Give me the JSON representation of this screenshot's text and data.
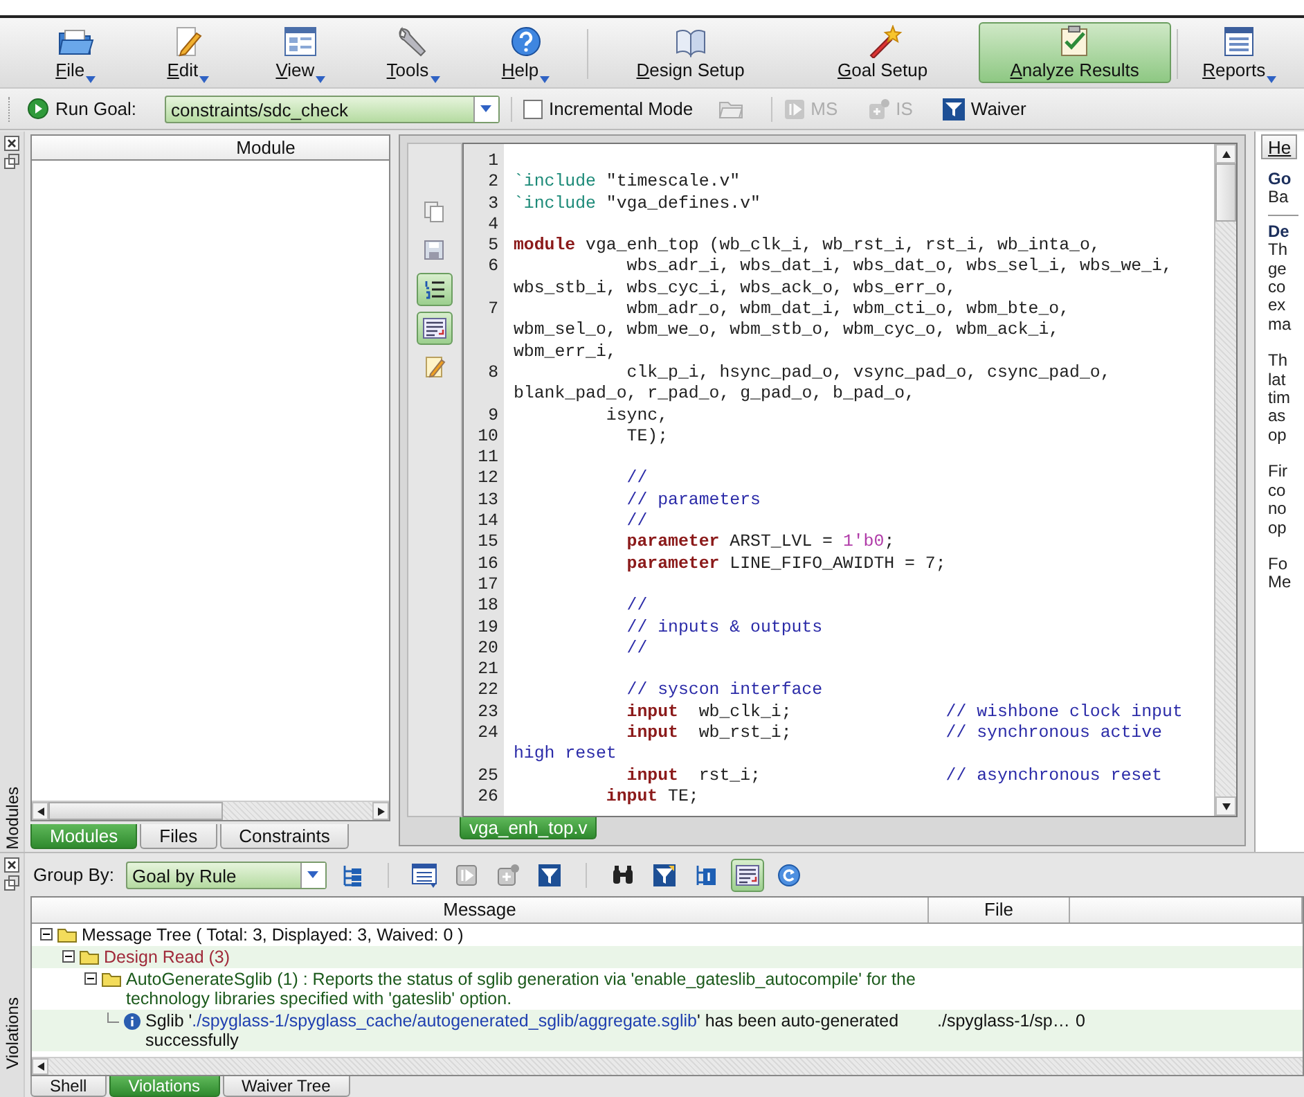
{
  "toolbar": {
    "items": [
      {
        "label": "File",
        "kind": "folder",
        "menu": true,
        "selected": false,
        "separator": false
      },
      {
        "label": "Edit",
        "kind": "pencil",
        "menu": true,
        "selected": false,
        "separator": false
      },
      {
        "label": "View",
        "kind": "panels",
        "menu": true,
        "selected": false,
        "separator": false
      },
      {
        "label": "Tools",
        "kind": "wrench",
        "menu": true,
        "selected": false,
        "separator": false
      },
      {
        "label": "Help",
        "kind": "help",
        "menu": true,
        "selected": false,
        "separator": false
      },
      {
        "label": "Design Setup",
        "kind": "book",
        "menu": false,
        "selected": false,
        "separator": true
      },
      {
        "label": "Goal Setup",
        "kind": "wand",
        "menu": false,
        "selected": false,
        "separator": false
      },
      {
        "label": "Analyze Results",
        "kind": "checklist",
        "menu": false,
        "selected": true,
        "separator": false
      },
      {
        "label": "Reports",
        "kind": "report",
        "menu": true,
        "selected": false,
        "separator": true
      }
    ]
  },
  "goal_bar": {
    "run_label": "Run Goal:",
    "goal": "constraints/sdc_check",
    "incremental": {
      "label": "Incremental Mode",
      "checked": false
    },
    "buttons": [
      {
        "kind": "folder",
        "disabled": true
      },
      {
        "kind": "ms",
        "label": "MS",
        "disabled": true
      },
      {
        "kind": "is",
        "label": "IS",
        "disabled": true
      },
      {
        "kind": "waiver",
        "label": "Waiver",
        "disabled": false
      }
    ]
  },
  "left_panel": {
    "side_label": "Modules",
    "column": "Module",
    "tabs": [
      {
        "label": "Modules",
        "selected": true
      },
      {
        "label": "Files",
        "selected": false
      },
      {
        "label": "Constraints",
        "selected": false
      }
    ]
  },
  "editor": {
    "tools": [
      {
        "kind": "copy",
        "active": false
      },
      {
        "kind": "save",
        "active": false
      },
      {
        "kind": "numbered-list",
        "active": true
      },
      {
        "kind": "wrap",
        "active": true
      },
      {
        "kind": "note",
        "active": false
      }
    ],
    "rows": [
      {
        "number": "1"
      },
      {
        "number": "2",
        "kind": "flush",
        "segments": [
          {
            "kind": "directive",
            "text": "`include"
          },
          {
            "kind": "string",
            "text": " \"timescale.v\""
          }
        ]
      },
      {
        "number": "3",
        "kind": "flush",
        "segments": [
          {
            "kind": "directive",
            "text": "`include"
          },
          {
            "kind": "string",
            "text": " \"vga_defines.v\""
          }
        ]
      },
      {
        "number": "4"
      },
      {
        "number": "5",
        "kind": "flush",
        "segments": [
          {
            "kind": "keyword",
            "text": "module"
          },
          {
            "kind": "plain",
            "text": " vga_enh_top (wb_clk_i, wb_rst_i, rst_i, wb_inta_o,"
          }
        ]
      },
      {
        "number": "6",
        "kind": "deep",
        "segments": [
          {
            "kind": "plain",
            "text": "wbs_adr_i, wbs_dat_i, wbs_dat_o, wbs_sel_i, wbs_we_i,"
          }
        ]
      },
      {
        "kind": "flush",
        "segments": [
          {
            "kind": "plain",
            "text": "wbs_stb_i, wbs_cyc_i, wbs_ack_o, wbs_err_o,"
          }
        ]
      },
      {
        "number": "7",
        "kind": "deep",
        "segments": [
          {
            "kind": "plain",
            "text": "wbm_adr_o, wbm_dat_i, wbm_cti_o, wbm_bte_o,"
          }
        ]
      },
      {
        "kind": "flush",
        "segments": [
          {
            "kind": "plain",
            "text": "wbm_sel_o, wbm_we_o, wbm_stb_o, wbm_cyc_o, wbm_ack_i,"
          }
        ]
      },
      {
        "kind": "flush",
        "segments": [
          {
            "kind": "plain",
            "text": "wbm_err_i,"
          }
        ]
      },
      {
        "number": "8",
        "kind": "deep",
        "segments": [
          {
            "kind": "plain",
            "text": "clk_p_i, hsync_pad_o, vsync_pad_o, csync_pad_o,"
          }
        ]
      },
      {
        "kind": "flush",
        "segments": [
          {
            "kind": "plain",
            "text": "blank_pad_o, r_pad_o, g_pad_o, b_pad_o,"
          }
        ]
      },
      {
        "number": "9",
        "kind": "shallow",
        "segments": [
          {
            "kind": "plain",
            "text": "isync,"
          }
        ]
      },
      {
        "number": "10",
        "kind": "deep",
        "segments": [
          {
            "kind": "plain",
            "text": "TE);"
          }
        ]
      },
      {
        "number": "11"
      },
      {
        "number": "12",
        "kind": "deep",
        "segments": [
          {
            "kind": "comment",
            "text": "//"
          }
        ]
      },
      {
        "number": "13",
        "kind": "deep",
        "segments": [
          {
            "kind": "comment",
            "text": "// parameters"
          }
        ]
      },
      {
        "number": "14",
        "kind": "deep",
        "segments": [
          {
            "kind": "comment",
            "text": "//"
          }
        ]
      },
      {
        "number": "15",
        "kind": "deep",
        "segments": [
          {
            "kind": "keyword",
            "text": "parameter"
          },
          {
            "kind": "plain",
            "text": " ARST_LVL = "
          },
          {
            "kind": "number",
            "text": "1'b0"
          },
          {
            "kind": "plain",
            "text": ";"
          }
        ]
      },
      {
        "number": "16",
        "kind": "deep",
        "segments": [
          {
            "kind": "keyword",
            "text": "parameter"
          },
          {
            "kind": "plain",
            "text": " LINE_FIFO_AWIDTH = 7;"
          }
        ]
      },
      {
        "number": "17"
      },
      {
        "number": "18",
        "kind": "deep",
        "segments": [
          {
            "kind": "comment",
            "text": "//"
          }
        ]
      },
      {
        "number": "19",
        "kind": "deep",
        "segments": [
          {
            "kind": "comment",
            "text": "// inputs & outputs"
          }
        ]
      },
      {
        "number": "20",
        "kind": "deep",
        "segments": [
          {
            "kind": "comment",
            "text": "//"
          }
        ]
      },
      {
        "number": "21"
      },
      {
        "number": "22",
        "kind": "deep",
        "segments": [
          {
            "kind": "comment",
            "text": "// syscon interface"
          }
        ]
      },
      {
        "number": "23",
        "kind": "deep",
        "segments": [
          {
            "kind": "keyword",
            "text": "input"
          },
          {
            "kind": "plain",
            "text": "  wb_clk_i;               "
          },
          {
            "kind": "comment",
            "text": "// wishbone clock input"
          }
        ]
      },
      {
        "number": "24",
        "kind": "deep",
        "segments": [
          {
            "kind": "keyword",
            "text": "input"
          },
          {
            "kind": "plain",
            "text": "  wb_rst_i;               "
          },
          {
            "kind": "comment",
            "text": "// synchronous active"
          }
        ]
      },
      {
        "kind": "flush",
        "segments": [
          {
            "kind": "comment",
            "text": "high reset"
          }
        ]
      },
      {
        "number": "25",
        "kind": "deep",
        "segments": [
          {
            "kind": "keyword",
            "text": "input"
          },
          {
            "kind": "plain",
            "text": "  rst_i;                  "
          },
          {
            "kind": "comment",
            "text": "// asynchronous reset"
          }
        ]
      },
      {
        "number": "26",
        "kind": "shallow",
        "segments": [
          {
            "kind": "keyword",
            "text": "input"
          },
          {
            "kind": "plain",
            "text": " TE;"
          }
        ]
      }
    ],
    "tabs": [
      {
        "label": "vga_enh_top.v",
        "selected": true
      }
    ]
  },
  "help": {
    "tab": "He",
    "lines": [
      {
        "kind": "heading",
        "text": "Go"
      },
      {
        "kind": "text",
        "text": "Ba"
      },
      {
        "kind": "rule"
      },
      {
        "kind": "heading",
        "text": "De"
      },
      {
        "kind": "text",
        "text": "Th"
      },
      {
        "kind": "text",
        "text": "ge"
      },
      {
        "kind": "text",
        "text": "co"
      },
      {
        "kind": "text",
        "text": "ex"
      },
      {
        "kind": "text",
        "text": "ma"
      },
      {
        "kind": "gap"
      },
      {
        "kind": "text",
        "text": "Th"
      },
      {
        "kind": "text",
        "text": "lat"
      },
      {
        "kind": "text",
        "text": "tim"
      },
      {
        "kind": "text",
        "text": "as"
      },
      {
        "kind": "text",
        "text": "op"
      },
      {
        "kind": "gap"
      },
      {
        "kind": "text",
        "text": "Fir"
      },
      {
        "kind": "text",
        "text": "co"
      },
      {
        "kind": "text",
        "text": "no"
      },
      {
        "kind": "text",
        "text": "op"
      },
      {
        "kind": "gap"
      },
      {
        "kind": "text",
        "text": "Fo"
      },
      {
        "kind": "text",
        "text": "Me"
      }
    ]
  },
  "violations": {
    "side_label": "Violations",
    "group_by_label": "Group By:",
    "group_by": "Goal by Rule",
    "tools": [
      {
        "kind": "tree",
        "active": false
      },
      {
        "kind": "list",
        "active": false
      },
      {
        "kind": "step",
        "active": false
      },
      {
        "kind": "add",
        "active": false
      },
      {
        "kind": "filter",
        "active": false
      },
      {
        "kind": "binoculars",
        "active": false
      },
      {
        "kind": "filter-edit",
        "active": false
      },
      {
        "kind": "numbered-tree",
        "active": false
      },
      {
        "kind": "wrap",
        "active": true
      },
      {
        "kind": "refresh",
        "active": false
      }
    ],
    "columns": [
      "Message",
      "File"
    ],
    "tree": [
      {
        "kind": "root",
        "label": "Message Tree ( Total: 3, Displayed: 3, Waived: 0 )",
        "expanded": true,
        "children": [
          {
            "kind": "group",
            "label": "Design Read (3)",
            "expanded": true,
            "children": [
              {
                "kind": "rule",
                "label": "AutoGenerateSglib (1) : Reports the status of sglib generation via 'enable_gateslib_autocompile' for the technology libraries specified with 'gateslib' option.",
                "expanded": true,
                "children": [
                  {
                    "kind": "message",
                    "segments": [
                      {
                        "kind": "plain",
                        "text": "Sglib '"
                      },
                      {
                        "kind": "path",
                        "text": "./spyglass-1/spyglass_cache/autogenerated_sglib/aggregate.sglib"
                      },
                      {
                        "kind": "plain",
                        "text": "' has been auto-generated successfully"
                      }
                    ],
                    "file": "./spyglass-1/sp…",
                    "column_3": "0"
                  }
                ]
              }
            ]
          }
        ]
      }
    ],
    "tabs": [
      {
        "label": "Shell",
        "selected": false
      },
      {
        "label": "Violations",
        "selected": true
      },
      {
        "label": "Waiver Tree",
        "selected": false
      }
    ]
  }
}
